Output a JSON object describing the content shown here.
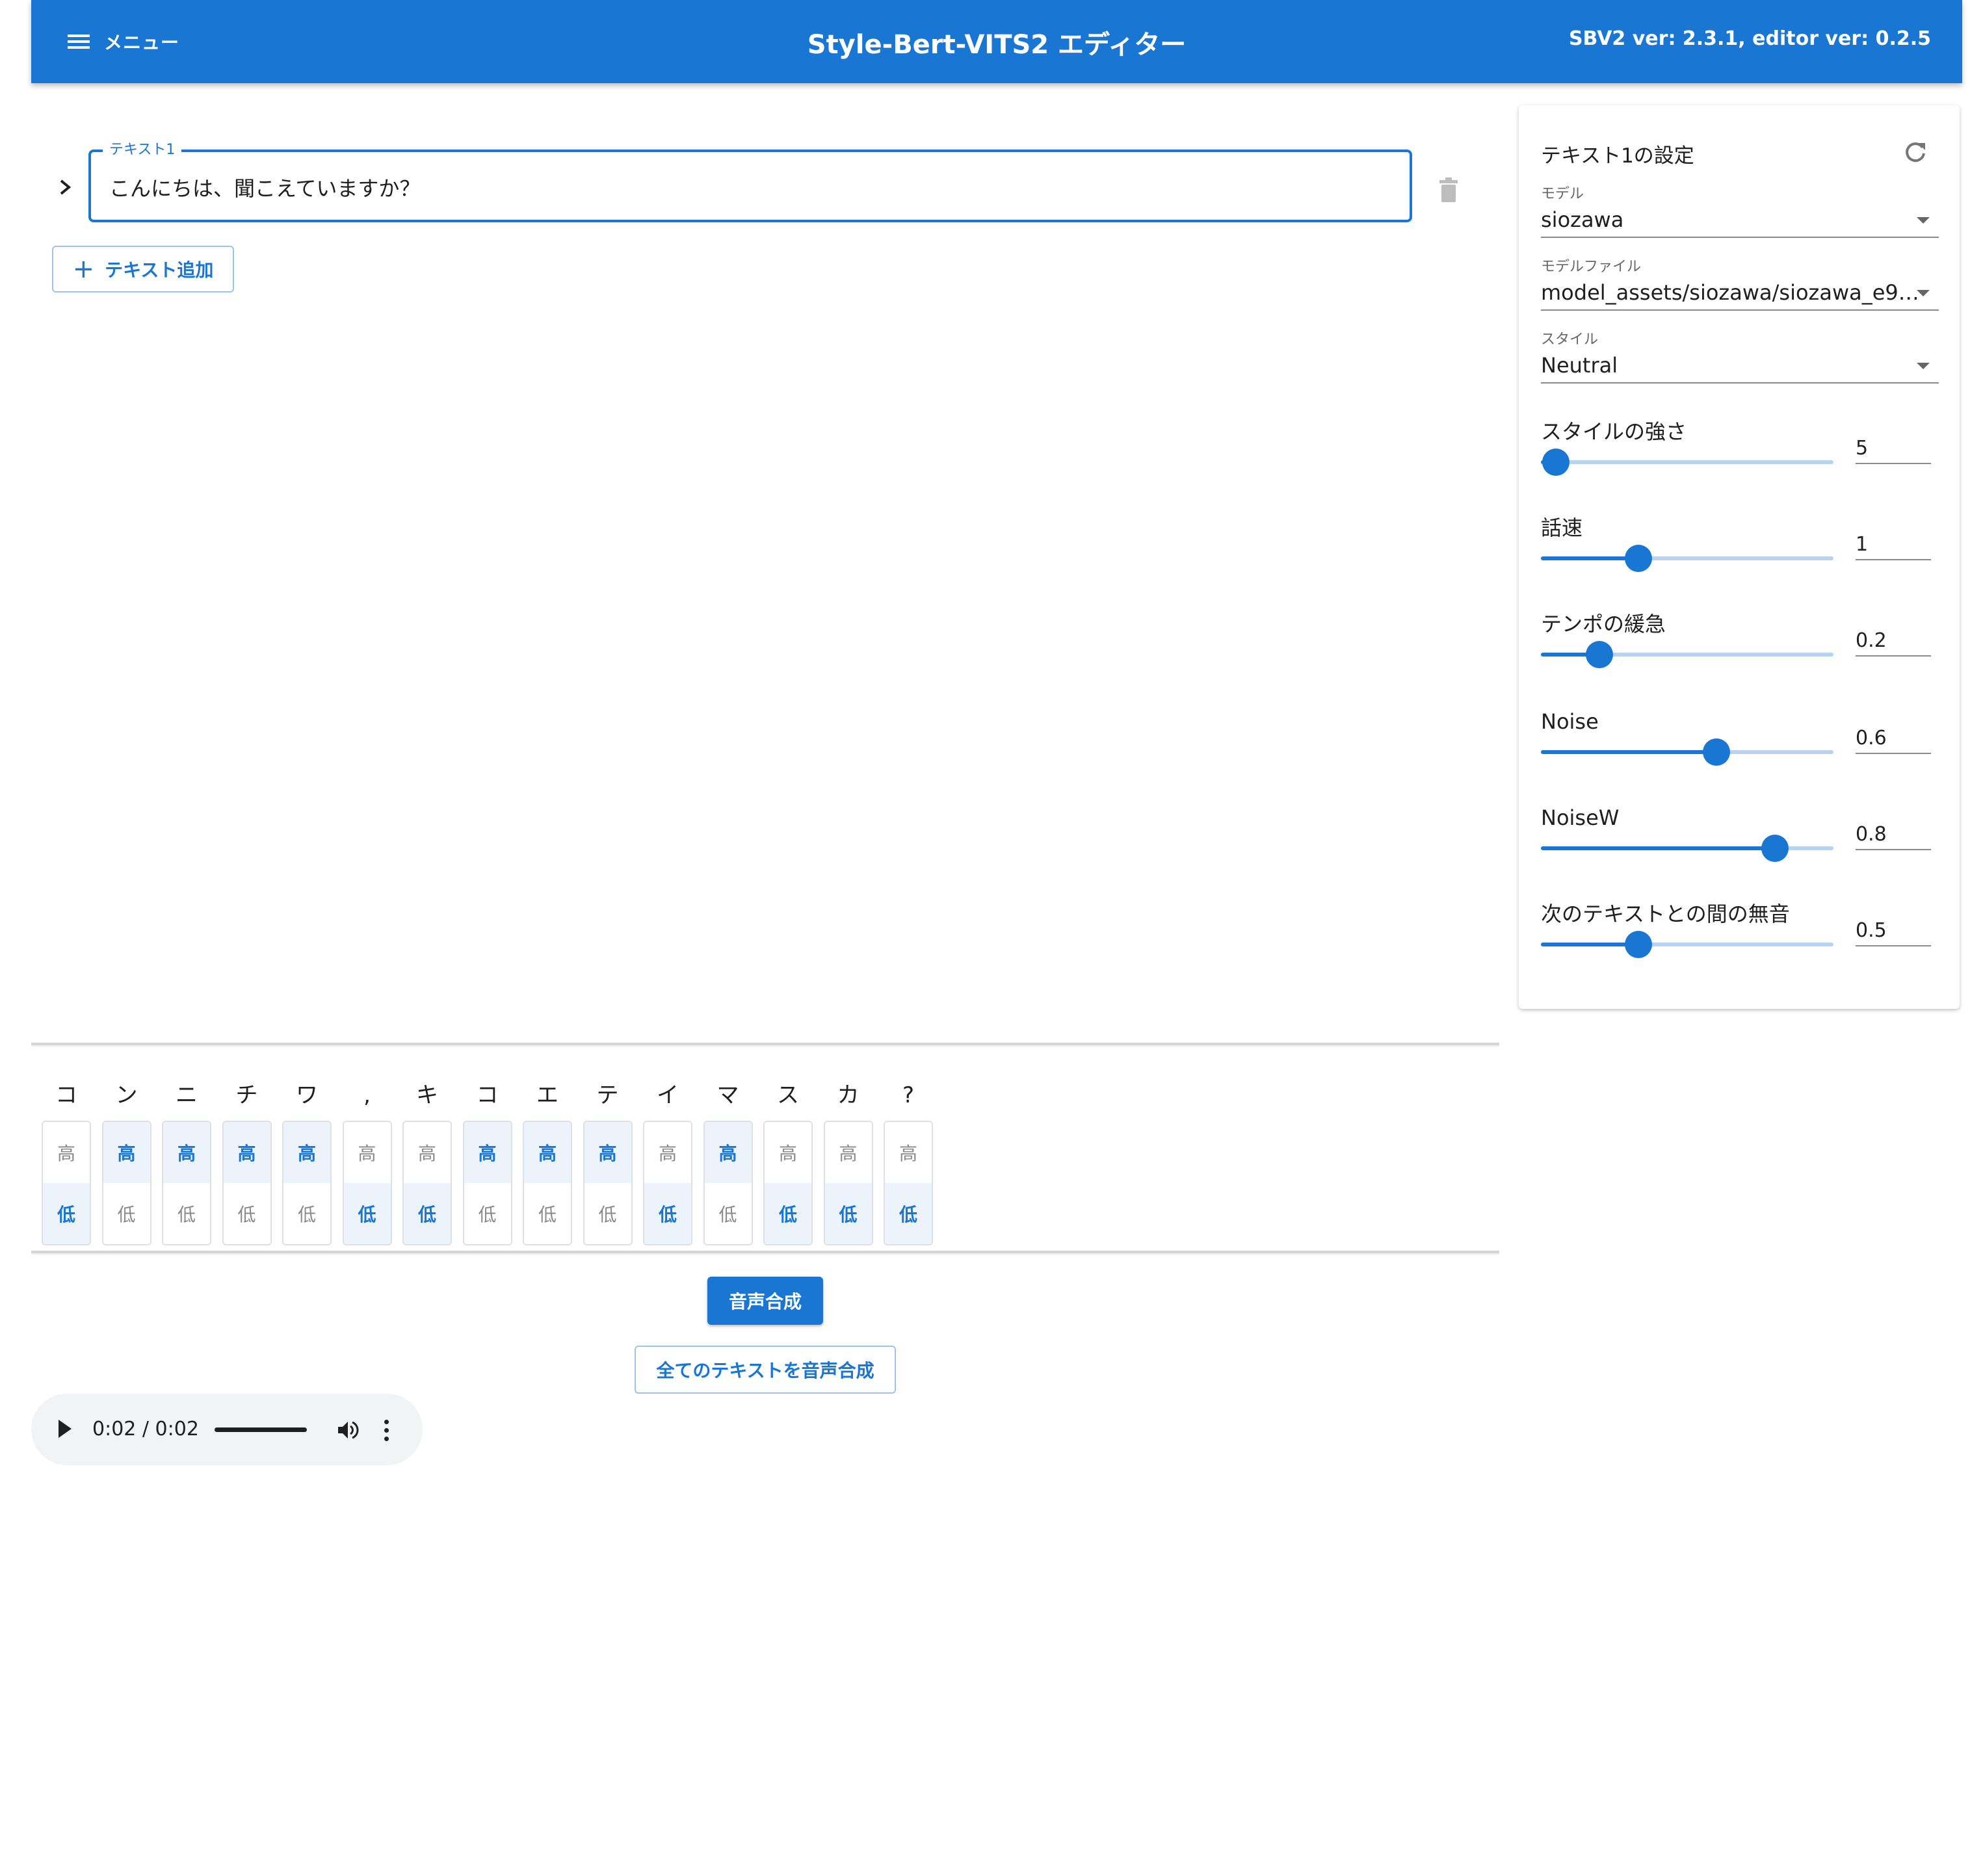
{
  "header": {
    "menu_label": "メニュー",
    "title": "Style-Bert-VITS2 エディター",
    "version": "SBV2 ver: 2.3.1, editor ver: 0.2.5"
  },
  "colors": {
    "primary": "#1976d2",
    "track_light": "#b7d3f2",
    "accent_on_bg": "#edf3fb"
  },
  "editor": {
    "text_label": "テキスト1",
    "text_value": "こんにちは、聞こえていますか？",
    "add_button": "テキスト追加"
  },
  "settings": {
    "title": "テキスト1の設定",
    "model": {
      "label": "モデル",
      "value": "siozawa"
    },
    "model_file": {
      "label": "モデルファイル",
      "value": "model_assets/siozawa/siozawa_e9…"
    },
    "style": {
      "label": "スタイル",
      "value": "Neutral"
    },
    "sliders": [
      {
        "label": "スタイルの強さ",
        "value": "5",
        "fraction": 0.05
      },
      {
        "label": "話速",
        "value": "1",
        "fraction": 0.333
      },
      {
        "label": "テンポの緩急",
        "value": "0.2",
        "fraction": 0.2
      },
      {
        "label": "Noise",
        "value": "0.6",
        "fraction": 0.6
      },
      {
        "label": "NoiseW",
        "value": "0.8",
        "fraction": 0.8
      },
      {
        "label": "次のテキストとの間の無音",
        "value": "0.5",
        "fraction": 0.333
      }
    ]
  },
  "accent": {
    "high_label": "高",
    "low_label": "低",
    "kana": [
      "コ",
      "ン",
      "ニ",
      "チ",
      "ワ",
      ",",
      "キ",
      "コ",
      "エ",
      "テ",
      "イ",
      "マ",
      "ス",
      "カ",
      "?"
    ],
    "levels": [
      "low",
      "high",
      "high",
      "high",
      "high",
      "low",
      "low",
      "high",
      "high",
      "high",
      "low",
      "high",
      "low",
      "low",
      "low"
    ]
  },
  "actions": {
    "synthesize": "音声合成",
    "synthesize_all": "全てのテキストを音声合成"
  },
  "audio": {
    "time": "0:02 / 0:02",
    "progress": 1.0
  }
}
